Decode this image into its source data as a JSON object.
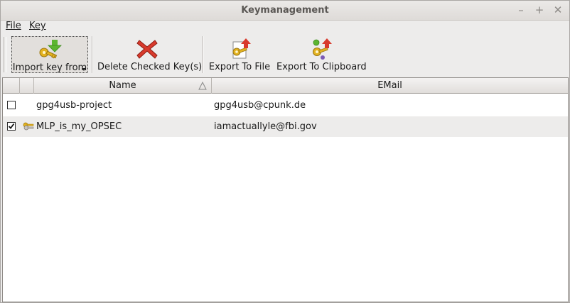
{
  "window": {
    "title": "Keymanagement",
    "controls": {
      "minimize": "–",
      "maximize": "+",
      "close": "✕"
    }
  },
  "menu": {
    "items": [
      {
        "label": "File"
      },
      {
        "label": "Key"
      }
    ]
  },
  "toolbar": {
    "import_label": "Import key from",
    "delete_label": "Delete Checked Key(s)",
    "export_file_label": "Export To File",
    "export_clipboard_label": "Export To Clipboard"
  },
  "table": {
    "columns": {
      "name": "Name",
      "email": "EMail"
    },
    "rows": [
      {
        "checked": false,
        "secret_key": false,
        "name": "gpg4usb-project",
        "email": "gpg4usb@cpunk.de"
      },
      {
        "checked": true,
        "secret_key": true,
        "name": "MLP_is_my_OPSEC",
        "email": "iamactuallyle@fbi.gov"
      }
    ]
  },
  "colors": {
    "window_bg": "#edeceb",
    "alt_row": "#edeceb",
    "delete_red": "#d83a2c",
    "import_green": "#5cb530",
    "key_gold": "#e3b21f"
  }
}
